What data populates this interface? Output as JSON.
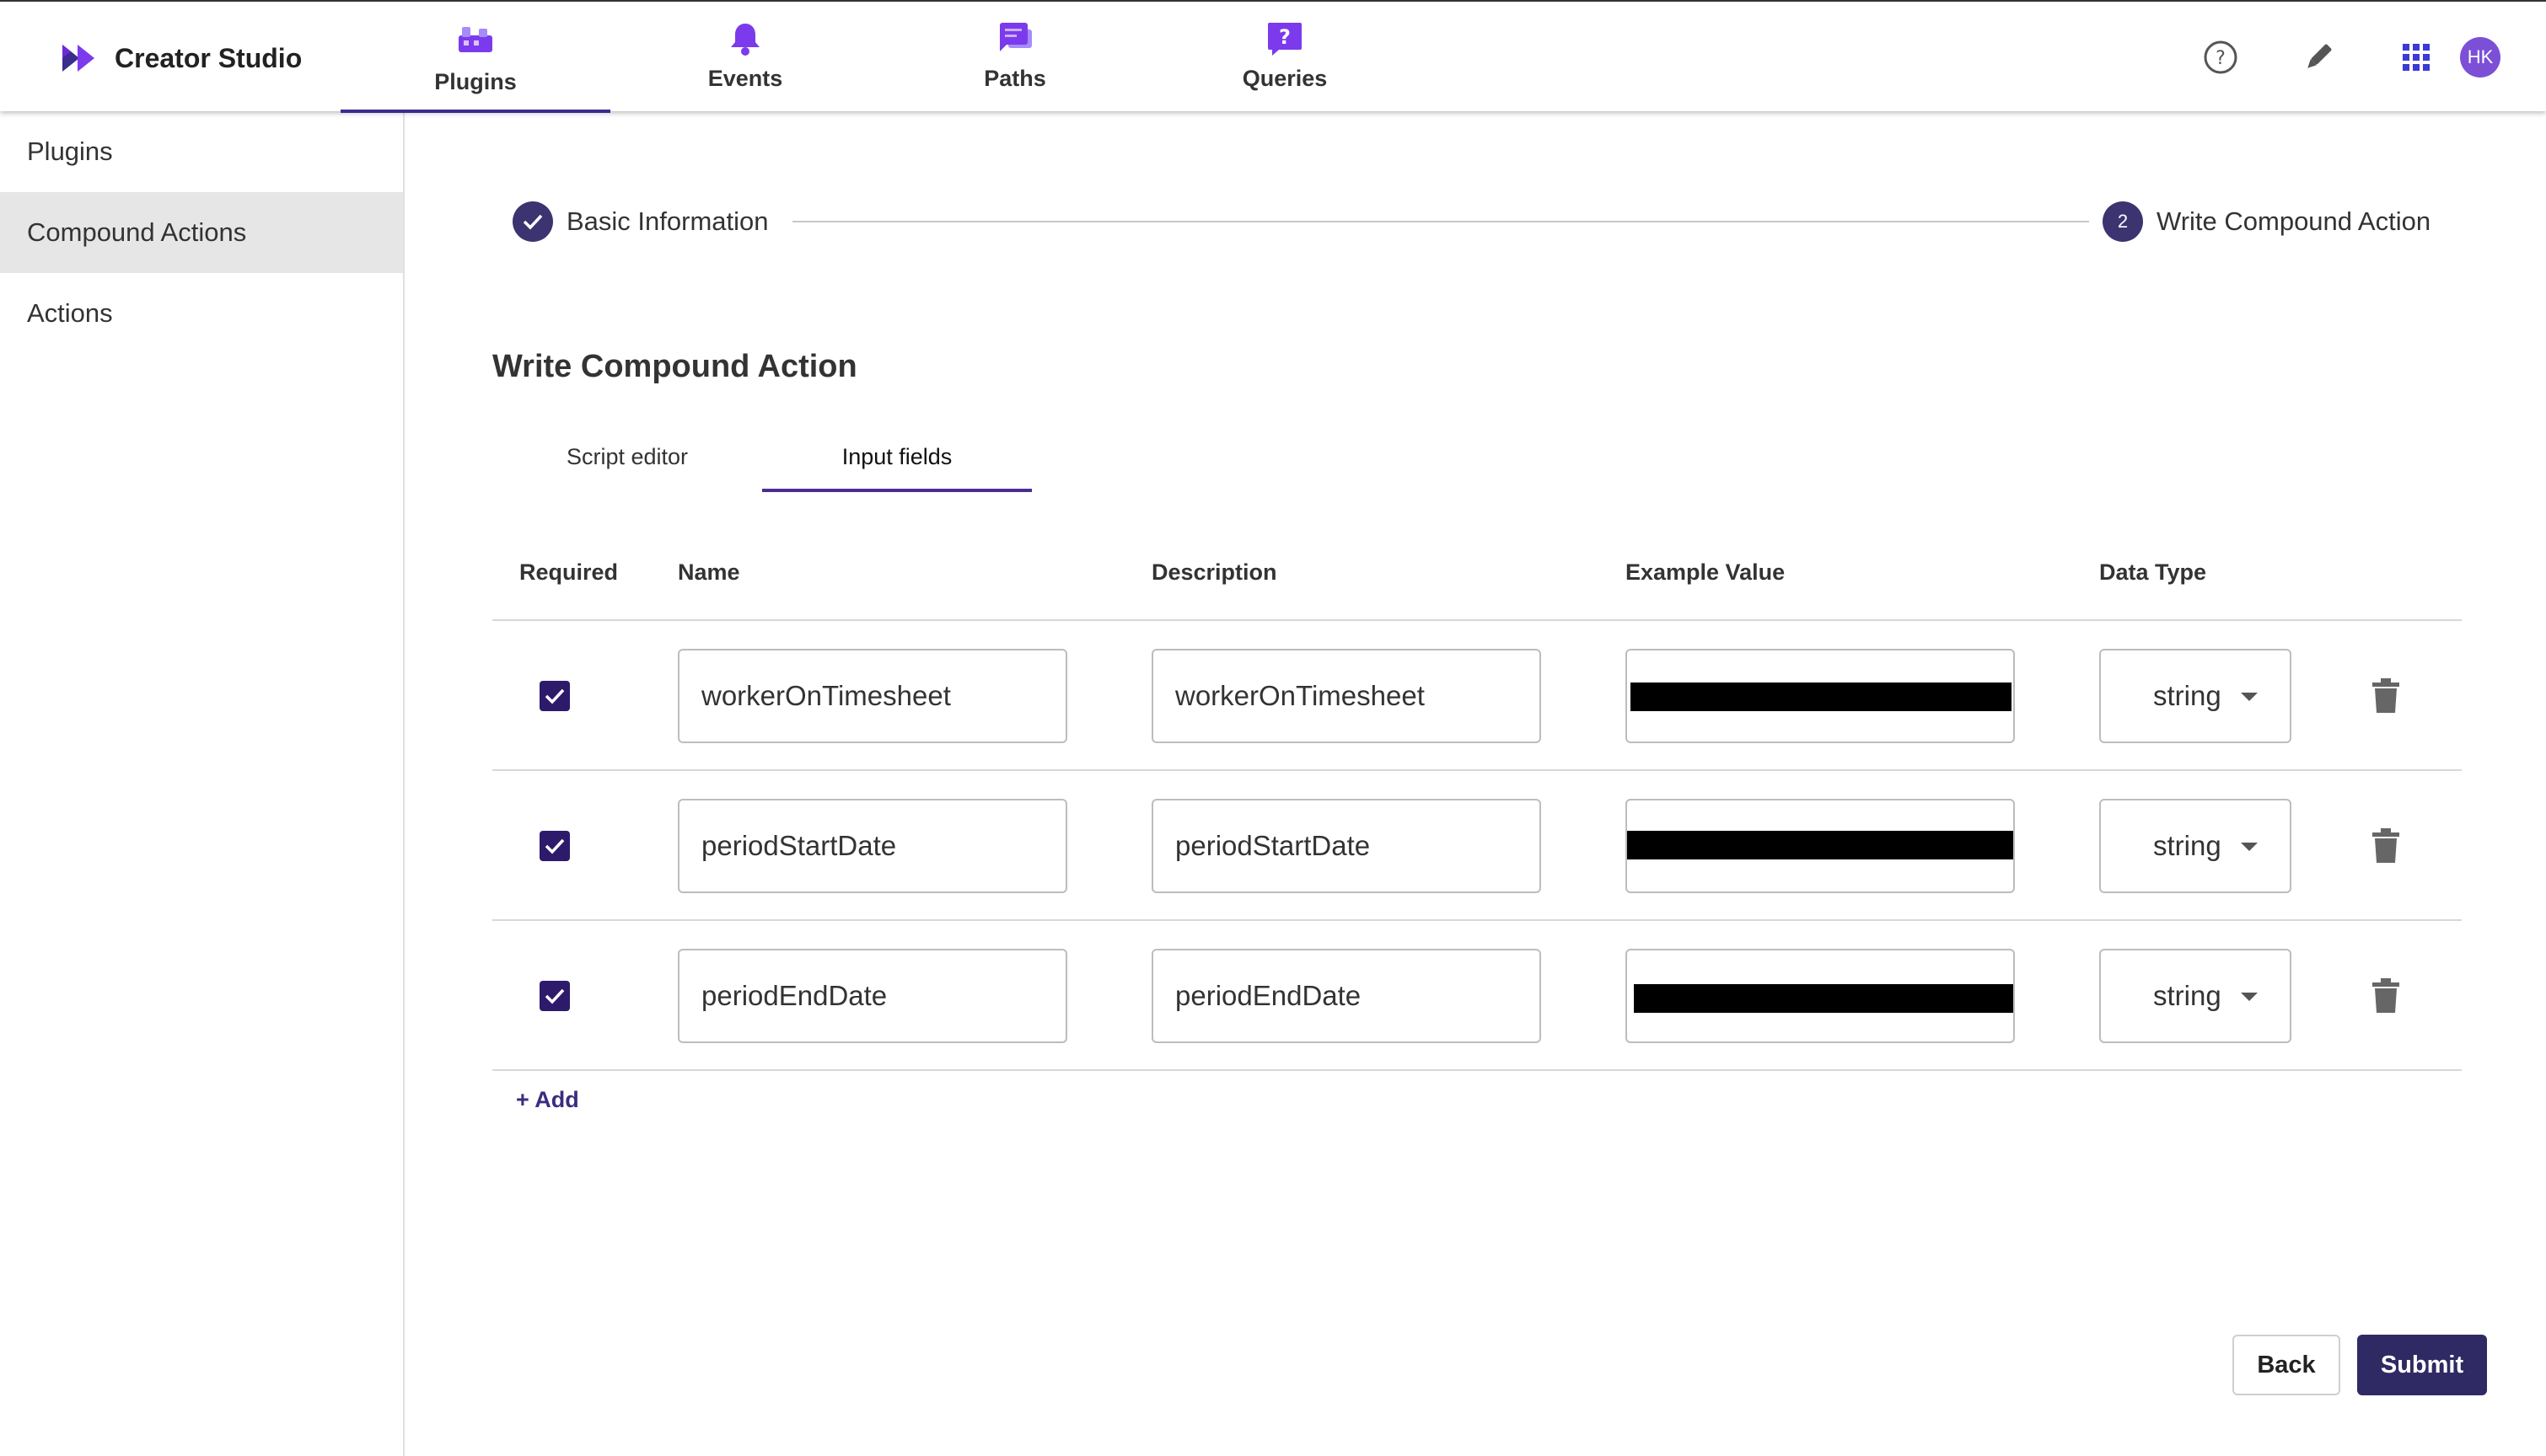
{
  "app": {
    "name": "Creator Studio"
  },
  "nav": {
    "tabs": [
      {
        "label": "Plugins",
        "icon": "plugins-icon",
        "active": true
      },
      {
        "label": "Events",
        "icon": "bell-icon",
        "active": false
      },
      {
        "label": "Paths",
        "icon": "chat-icon",
        "active": false
      },
      {
        "label": "Queries",
        "icon": "question-chat-icon",
        "active": false
      }
    ],
    "accent": "#7c3aed"
  },
  "top_actions": {
    "help": "help-icon",
    "tools": "pen-icon",
    "apps": "apps-grid-icon",
    "avatar_initials": "HK"
  },
  "sidebar": {
    "items": [
      {
        "label": "Plugins",
        "active": false
      },
      {
        "label": "Compound Actions",
        "active": true
      },
      {
        "label": "Actions",
        "active": false
      }
    ]
  },
  "stepper": {
    "steps": [
      {
        "label": "Basic Information",
        "state": "done"
      },
      {
        "number": "2",
        "label": "Write Compound Action",
        "state": "current"
      }
    ]
  },
  "section": {
    "title": "Write Compound Action",
    "tabs": [
      {
        "label": "Script editor",
        "active": false
      },
      {
        "label": "Input fields",
        "active": true
      }
    ]
  },
  "table": {
    "headers": {
      "required": "Required",
      "name": "Name",
      "description": "Description",
      "example": "Example Value",
      "type": "Data Type"
    },
    "rows": [
      {
        "required": true,
        "name": "workerOnTimesheet",
        "description": "workerOnTimesheet",
        "example": "[redacted]",
        "type": "string"
      },
      {
        "required": true,
        "name": "periodStartDate",
        "description": "periodStartDate",
        "example": "[redacted]",
        "type": "string"
      },
      {
        "required": true,
        "name": "periodEndDate",
        "description": "periodEndDate",
        "example": "[redacted]",
        "type": "string"
      }
    ]
  },
  "add_label": "+ Add",
  "footer": {
    "back": "Back",
    "submit": "Submit"
  },
  "colors": {
    "primary": "#2f2a63",
    "checkbox": "#2e1a6b",
    "tab_underline": "#4a2d94"
  }
}
